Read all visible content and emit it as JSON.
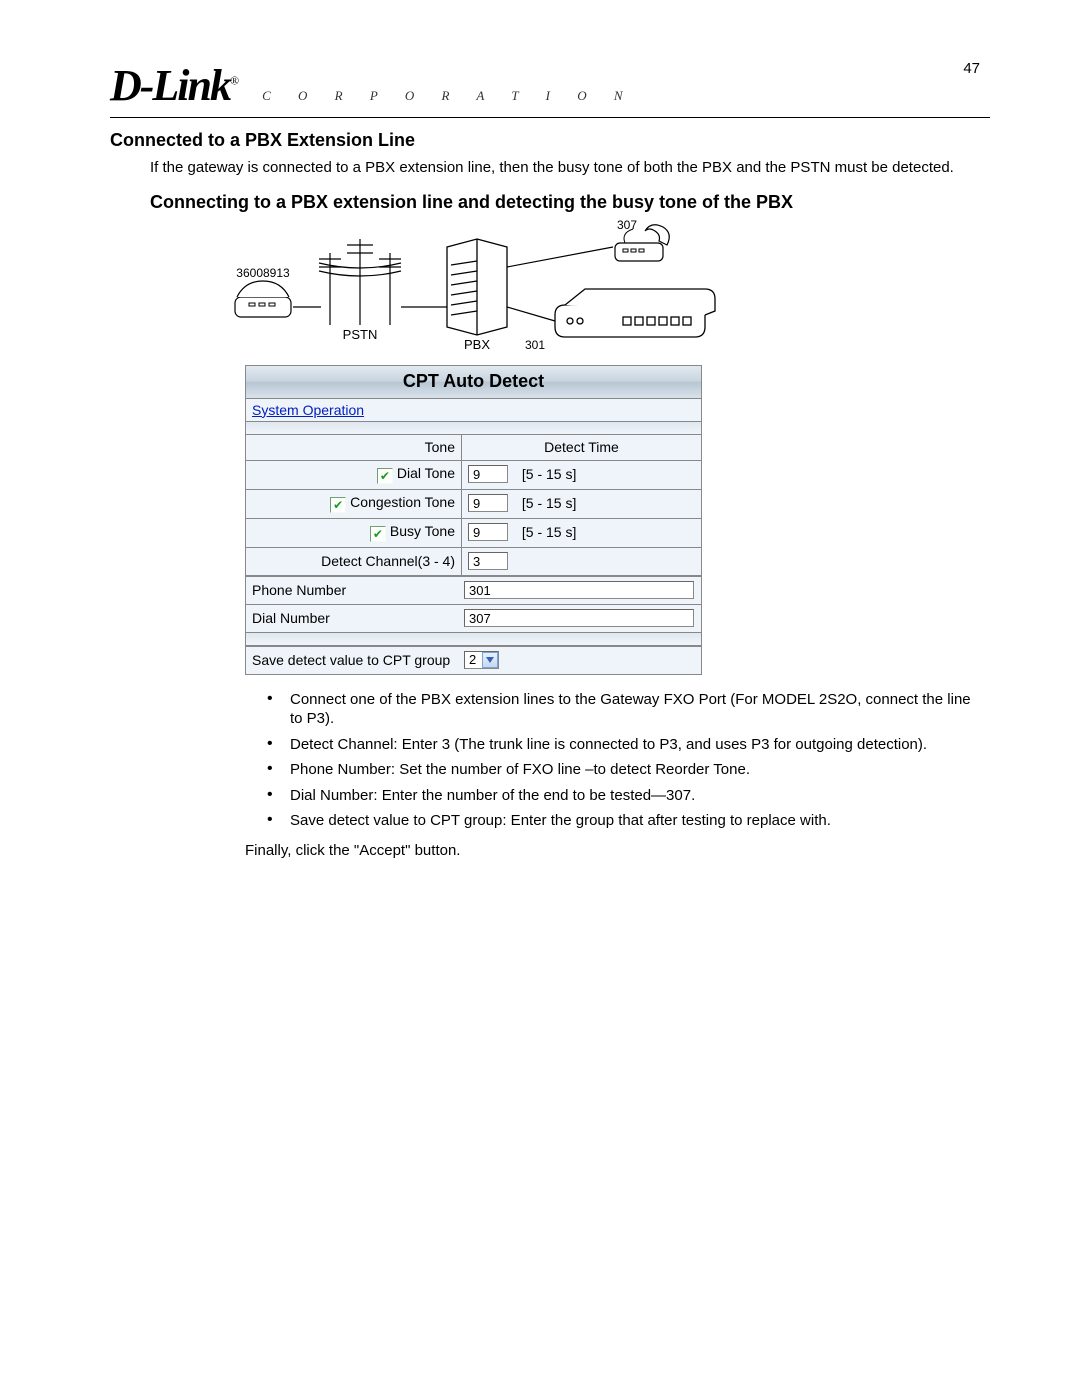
{
  "page_number": "47",
  "brand": {
    "name": "D-Link",
    "reg": "®",
    "sub": "C O R P O R A T I O N"
  },
  "heading1": "Connected to a PBX Extension Line",
  "para1": "If the gateway is connected to a PBX extension line, then the busy tone of both the PBX and the PSTN must be detected.",
  "heading2": "Connecting to a PBX extension line and detecting the busy tone of the PBX",
  "diagram": {
    "outside_num": "36008913",
    "pstn_label": "PSTN",
    "pbx_label": "PBX",
    "gw_port": "301",
    "phone_ext": "307"
  },
  "panel": {
    "title": "CPT Auto Detect",
    "sys_op_link": "System Operation",
    "head_tone": "Tone",
    "head_detect_time": "Detect Time",
    "rows": [
      {
        "label": "Dial Tone",
        "checked": true,
        "value": "9",
        "range": "[5 - 15 s]"
      },
      {
        "label": "Congestion Tone",
        "checked": true,
        "value": "9",
        "range": "[5 - 15 s]"
      },
      {
        "label": "Busy Tone",
        "checked": true,
        "value": "9",
        "range": "[5 - 15 s]"
      }
    ],
    "detect_channel_label": "Detect Channel(3 - 4)",
    "detect_channel_value": "3",
    "phone_number_label": "Phone Number",
    "phone_number_value": "301",
    "dial_number_label": "Dial Number",
    "dial_number_value": "307",
    "cpt_group_label": "Save detect value to CPT group",
    "cpt_group_value": "2"
  },
  "bullets": [
    "Connect one of the PBX extension lines to the Gateway FXO Port (For MODEL 2S2O, connect the line to P3).",
    "Detect Channel: Enter 3 (The trunk line is connected to P3, and uses P3 for outgoing detection).",
    "Phone Number: Set the number of FXO line –to detect Reorder Tone.",
    "Dial Number: Enter the number of the end to be tested—307.",
    "Save detect value to CPT group: Enter the group that after testing to replace with."
  ],
  "final": "Finally, click the \"Accept\" button."
}
